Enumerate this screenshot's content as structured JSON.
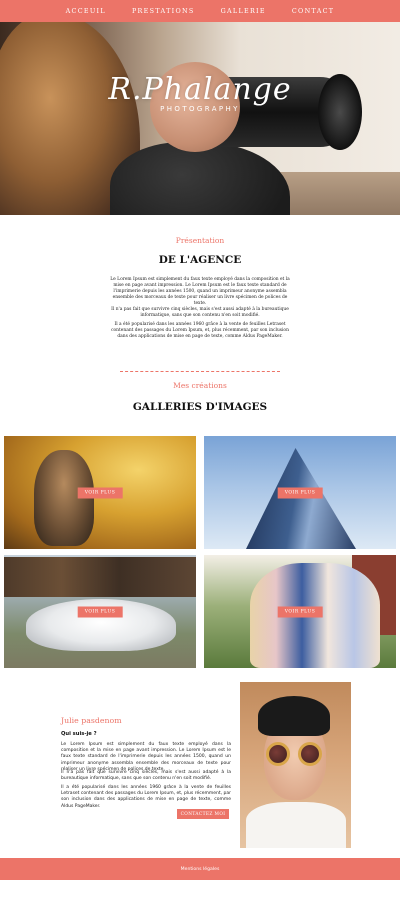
{
  "nav": {
    "items": [
      "ACCEUIL",
      "PRESTATIONS",
      "GALLERIE",
      "CONTACT"
    ]
  },
  "hero": {
    "logo_script": "R.Phalange",
    "logo_sub": "PHOTOGRAPHY"
  },
  "presentation": {
    "kicker": "Présentation",
    "title": "DE L'AGENCE",
    "paragraphs": [
      "Le Lorem Ipsum est simplement du faux texte employé dans la composition et la mise en page avant impression. Le Lorem Ipsum est le faux texte standard de l'imprimerie depuis les années 1500, quand un imprimeur anonyme assembla ensemble des morceaux de texte pour réaliser un livre spécimen de polices de texte.",
      "Il n'a pas fait que survivre cinq siècles, mais s'est aussi adapté à la bureautique informatique, sans que son contenu n'en soit modifié.",
      "Il a été popularisé dans les années 1960 grâce à la vente de feuilles Letraset contenant des passages du Lorem Ipsum, et, plus récemment, par son inclusion dans des applications de mise en page de texte, comme Aldus PageMaker."
    ]
  },
  "gallery": {
    "kicker": "Mes créations",
    "title": "GALLERIES D'IMAGES",
    "button_label": "VOIR PLUS"
  },
  "about": {
    "name": "Julie pasdenom",
    "question": "Qui suis-je ?",
    "paragraphs": [
      "Le Lorem Ipsum est simplement du faux texte employé dans la composition et la mise en page avant impression. Le Lorem Ipsum est le faux texte standard de l'imprimerie depuis les années 1500, quand un imprimeur anonyme assembla ensemble des morceaux de texte pour réaliser un livre spécimen de polices de texte.",
      "Il n'a pas fait que survivre cinq siècles, mais s'est aussi adapté à la bureautique informatique, sans que son contenu n'en soit modifié.",
      "Il a été popularisé dans les années 1960 grâce à la vente de feuilles Letraset contenant des passages du Lorem Ipsum, et, plus récemment, par son inclusion dans des applications de mise en page de texte, comme Aldus PageMaker."
    ],
    "contact_label": "CONTACTEZ MOI"
  },
  "footer": {
    "legal": "Mentions légales"
  },
  "colors": {
    "accent": "#ec7468"
  }
}
